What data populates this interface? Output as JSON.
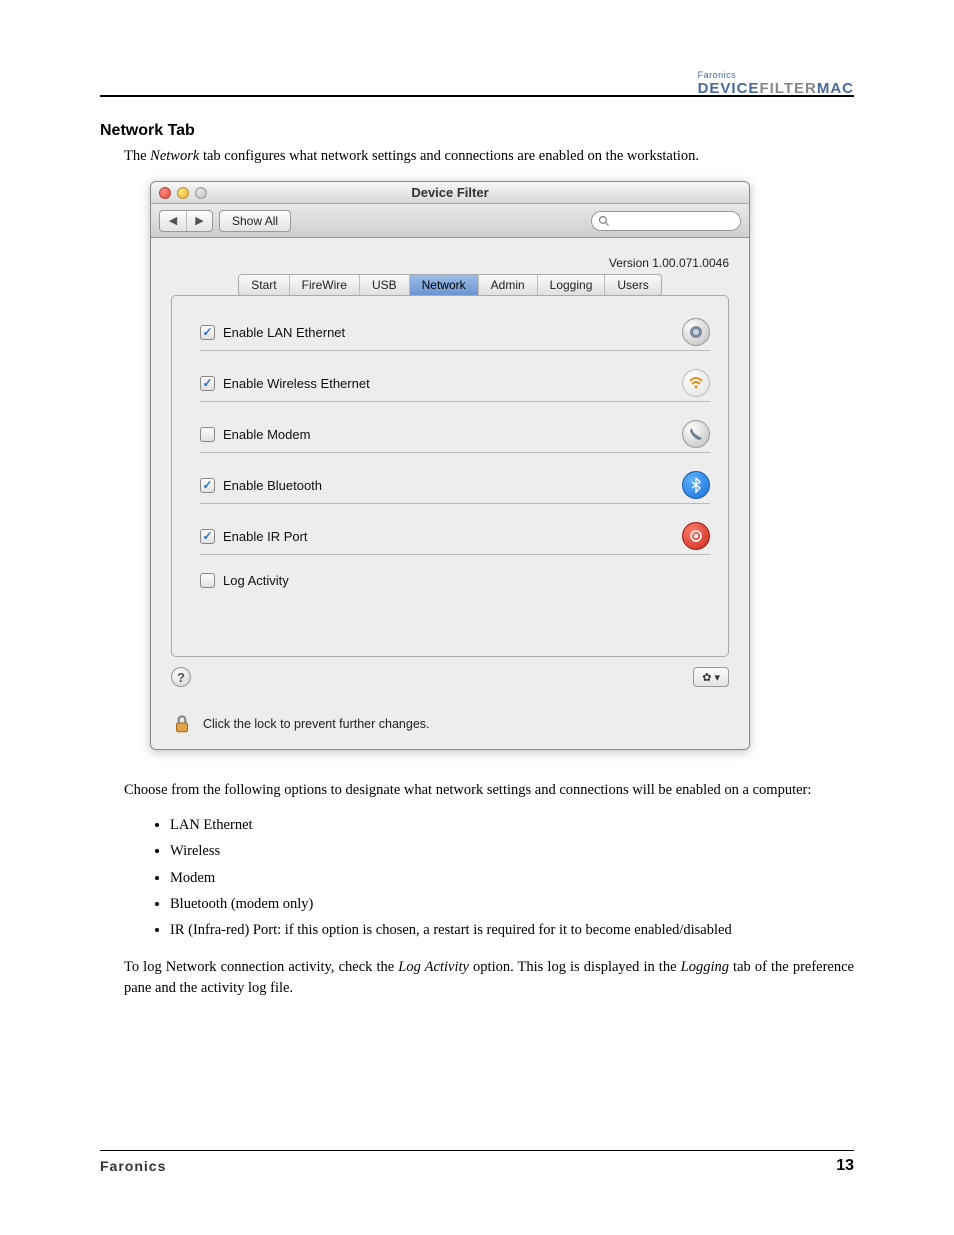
{
  "header": {
    "brand_small": "Faronics",
    "brand_big_1": "DEVICE",
    "brand_big_2": "FILTER",
    "brand_big_3": "MAC"
  },
  "section_title": "Network Tab",
  "intro": {
    "pre": "The ",
    "em": "Network",
    "post": " tab configures what network settings and connections are enabled on the workstation."
  },
  "window": {
    "title": "Device Filter",
    "nav_back": "◀",
    "nav_fwd": "▶",
    "show_all": "Show All",
    "version": "Version 1.00.071.0046",
    "tabs": [
      "Start",
      "FireWire",
      "USB",
      "Network",
      "Admin",
      "Logging",
      "Users"
    ],
    "active_tab_index": 3,
    "options": [
      {
        "label": "Enable LAN Ethernet",
        "checked": true,
        "icon": "ethernet"
      },
      {
        "label": "Enable Wireless Ethernet",
        "checked": true,
        "icon": "wifi"
      },
      {
        "label": "Enable Modem",
        "checked": false,
        "icon": "phone"
      },
      {
        "label": "Enable Bluetooth",
        "checked": true,
        "icon": "bluetooth"
      },
      {
        "label": "Enable IR Port",
        "checked": true,
        "icon": "ir"
      },
      {
        "label": "Log Activity",
        "checked": false,
        "icon": ""
      }
    ],
    "help": "?",
    "gear": "✿",
    "gear_caret": "▾",
    "lock_text": "Click the lock to prevent further changes."
  },
  "para2": "Choose from the following options to designate what network settings and connections will be enabled on a computer:",
  "list": [
    "LAN Ethernet",
    "Wireless",
    "Modem",
    "Bluetooth (modem only)",
    "IR (Infra-red) Port: if this option is chosen, a restart is required for it to become enabled/disabled"
  ],
  "para3": {
    "p1": "To log Network connection activity, check the ",
    "em1": "Log Activity",
    "p2": " option. This log is displayed in the ",
    "em2": "Logging",
    "p3": " tab of the preference pane and the activity log file."
  },
  "footer": {
    "brand": "Faronics",
    "page": "13"
  }
}
